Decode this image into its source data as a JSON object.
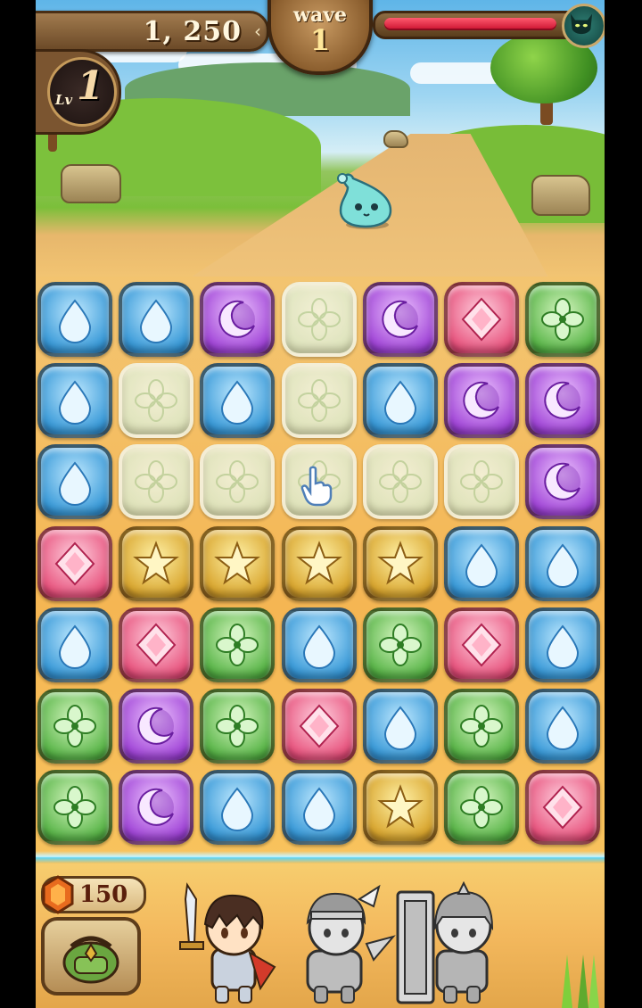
{
  "hud": {
    "score": "1, 250",
    "wave_label": "wave",
    "wave_number": "1",
    "level_prefix": "Lv",
    "level_number": "1",
    "enemy_hp_fraction": 0.92
  },
  "board": {
    "columns": 7,
    "rows": 7,
    "tiles": [
      [
        "water",
        "water",
        "moon",
        "ghost",
        "moon",
        "heart",
        "clover"
      ],
      [
        "water",
        "ghost",
        "water",
        "ghost",
        "water",
        "moon",
        "moon"
      ],
      [
        "water",
        "ghost",
        "ghost",
        "ghost",
        "ghost",
        "ghost",
        "moon"
      ],
      [
        "heart",
        "star",
        "star",
        "star",
        "star",
        "water",
        "water"
      ],
      [
        "water",
        "heart",
        "clover",
        "water",
        "clover",
        "heart",
        "water"
      ],
      [
        "clover",
        "moon",
        "clover",
        "heart",
        "water",
        "clover",
        "water"
      ],
      [
        "clover",
        "moon",
        "water",
        "water",
        "star",
        "clover",
        "heart"
      ]
    ]
  },
  "bottom": {
    "gem_count": "150"
  },
  "party": [
    {
      "icon": "swordsman-hero-icon",
      "active": true
    },
    {
      "icon": "winged-helmet-hero-icon",
      "active": false
    },
    {
      "icon": "shield-knight-hero-icon",
      "active": false
    }
  ],
  "colors": {
    "enemy_hp": "#d41a35",
    "water": "#3a9ad8",
    "moon": "#a247d8",
    "heart": "#e8557f",
    "clover": "#5bb64a",
    "star": "#d9a62f"
  }
}
